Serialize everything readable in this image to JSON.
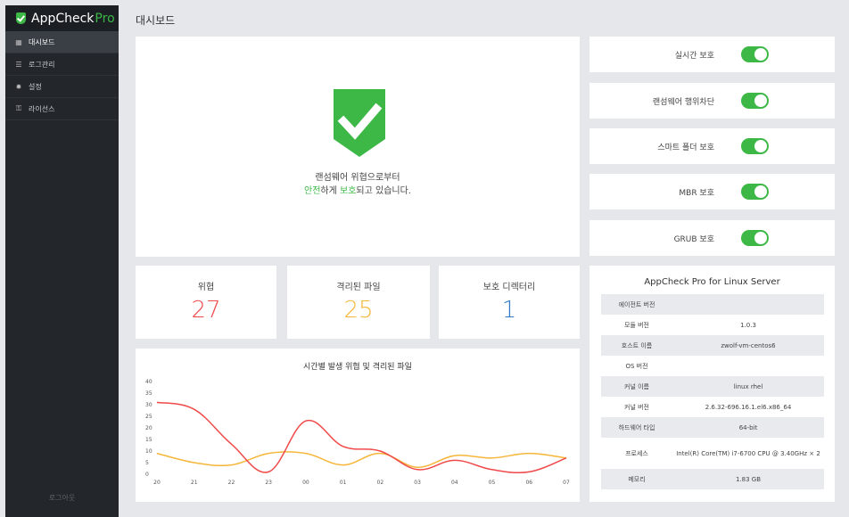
{
  "app": {
    "name": "AppCheck",
    "name_pro": "Pro"
  },
  "sidebar": {
    "items": [
      {
        "label": "대시보드",
        "icon": "grid-icon",
        "active": true
      },
      {
        "label": "로그관리",
        "icon": "list-icon",
        "active": false
      },
      {
        "label": "설정",
        "icon": "gear-icon",
        "active": false
      },
      {
        "label": "라이선스",
        "icon": "key-icon",
        "active": false
      }
    ],
    "logout_label": "로그아웃"
  },
  "header": {
    "title": "대시보드"
  },
  "status": {
    "line1": "랜섬웨어 위협으로부터",
    "safe": "안전",
    "mid": "하게 ",
    "protected": "보호",
    "end": "되고 있습니다."
  },
  "toggles": [
    {
      "label": "실시간 보호",
      "on": true
    },
    {
      "label": "랜섬웨어 행위차단",
      "on": true
    },
    {
      "label": "스마트 폴더 보호",
      "on": true
    },
    {
      "label": "MBR 보호",
      "on": true
    },
    {
      "label": "GRUB 보호",
      "on": true
    }
  ],
  "stats": [
    {
      "label": "위협",
      "value": "27",
      "color": "#f0494a"
    },
    {
      "label": "격리된 파일",
      "value": "25",
      "color": "#f5b63a"
    },
    {
      "label": "보호 디렉터리",
      "value": "1",
      "color": "#2e78c8"
    }
  ],
  "info": {
    "title": "AppCheck Pro for Linux Server",
    "rows": [
      {
        "key": "에이전트 버전",
        "value": ""
      },
      {
        "key": "모듈 버전",
        "value": "1.0.3"
      },
      {
        "key": "호스트 이름",
        "value": "zwolf-vm-centos6"
      },
      {
        "key": "OS 버전",
        "value": ""
      },
      {
        "key": "커널 이름",
        "value": "linux rhel"
      },
      {
        "key": "커널 버전",
        "value": "2.6.32-696.16.1.el6.x86_64"
      },
      {
        "key": "하드웨어 타입",
        "value": "64-bit"
      },
      {
        "key": "프로세스",
        "value": "Intel(R) Core(TM) i7-6700 CPU @ 3.40GHz × 2"
      },
      {
        "key": "메모리",
        "value": "1.83 GB"
      }
    ]
  },
  "chart_data": {
    "type": "line",
    "title": "시간별 발생 위협 및 격리된 파일",
    "categories": [
      "20",
      "21",
      "22",
      "23",
      "00",
      "01",
      "02",
      "03",
      "04",
      "05",
      "06",
      "07"
    ],
    "ylim": [
      0,
      40
    ],
    "yticks": [
      0,
      5,
      10,
      15,
      20,
      25,
      30,
      35,
      40
    ],
    "grid": false,
    "series": [
      {
        "values": [
          31,
          28,
          13,
          1,
          23,
          12,
          10,
          2,
          6,
          2,
          1,
          7
        ],
        "color": "#f0494a"
      },
      {
        "values": [
          9,
          5,
          4,
          9,
          9,
          4,
          9,
          3,
          8,
          7,
          9,
          7
        ],
        "color": "#f5b63a"
      }
    ]
  },
  "colors": {
    "accent": "#3db847",
    "sidebar_bg": "#23272c",
    "page_bg": "#e5e7ea"
  }
}
